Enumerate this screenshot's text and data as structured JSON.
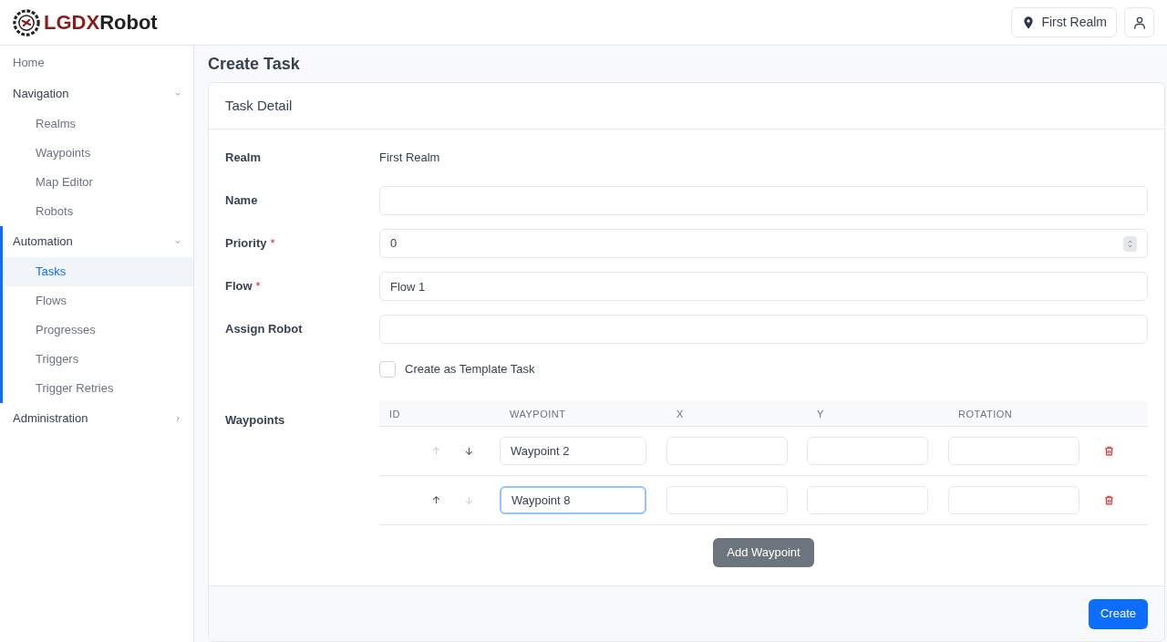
{
  "header": {
    "brand": {
      "part_1": "LGDX",
      "part_2": "Robot"
    },
    "realm_button": "First Realm"
  },
  "sidebar": {
    "items": [
      {
        "label": "Home",
        "kind": "link",
        "selected": false
      },
      {
        "label": "Navigation",
        "kind": "group",
        "expanded": true,
        "children": [
          {
            "label": "Realms",
            "selected": false
          },
          {
            "label": "Waypoints",
            "selected": false
          },
          {
            "label": "Map Editor",
            "selected": false
          },
          {
            "label": "Robots",
            "selected": false
          }
        ]
      },
      {
        "label": "Automation",
        "kind": "group",
        "expanded": true,
        "children": [
          {
            "label": "Tasks",
            "selected": true
          },
          {
            "label": "Flows",
            "selected": false
          },
          {
            "label": "Progresses",
            "selected": false
          },
          {
            "label": "Triggers",
            "selected": false
          },
          {
            "label": "Trigger Retries",
            "selected": false
          }
        ]
      },
      {
        "label": "Administration",
        "kind": "group",
        "expanded": false
      }
    ]
  },
  "page_title": "Create Task",
  "card": {
    "title": "Task Detail",
    "fields": [
      {
        "label": "Realm",
        "kind": "static",
        "value": "First Realm"
      },
      {
        "label": "Name",
        "kind": "text"
      },
      {
        "label": "Priority",
        "kind": "number",
        "required_mark": "*",
        "value": "0"
      },
      {
        "label": "Flow",
        "kind": "text",
        "required_mark": "*",
        "value": "Flow 1"
      },
      {
        "label": "Assign Robot",
        "kind": "text"
      },
      {
        "label": "Create as Template Task",
        "kind": "checkbox",
        "checked": false
      }
    ],
    "waypoints": {
      "label": "Waypoints",
      "columns": [
        "ID",
        "WAYPOINT",
        "X",
        "Y",
        "ROTATION"
      ],
      "rows": [
        {
          "waypoint": "Waypoint 2",
          "up_disabled": true,
          "down_disabled": false,
          "focused": false
        },
        {
          "waypoint": "Waypoint 8",
          "up_disabled": false,
          "down_disabled": true,
          "focused": true
        }
      ],
      "add_button": "Add Waypoint"
    },
    "submit_button": "Create"
  }
}
